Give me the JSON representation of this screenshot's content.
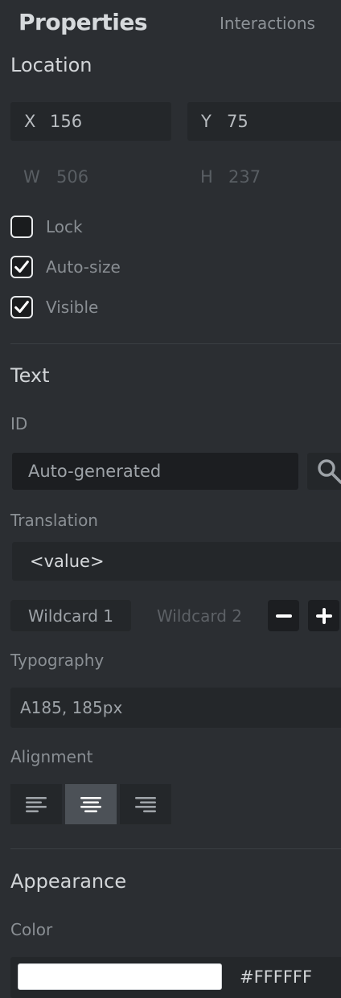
{
  "tabs": {
    "properties": "Properties",
    "interactions": "Interactions"
  },
  "location": {
    "title": "Location",
    "x_label": "X",
    "x_value": "156",
    "y_label": "Y",
    "y_value": "75",
    "w_label": "W",
    "w_value": "506",
    "h_label": "H",
    "h_value": "237",
    "checkboxes": [
      {
        "label": "Lock",
        "checked": false
      },
      {
        "label": "Auto-size",
        "checked": true
      },
      {
        "label": "Visible",
        "checked": true
      }
    ]
  },
  "text": {
    "title": "Text",
    "id_label": "ID",
    "id_placeholder": "Auto-generated",
    "translation_label": "Translation",
    "translation_value": "<value>",
    "wildcards": [
      "Wildcard 1",
      "Wildcard 2"
    ],
    "typography_label": "Typography",
    "typography_value": "A185, 185px",
    "alignment_label": "Alignment",
    "alignment_selected": "center"
  },
  "appearance": {
    "title": "Appearance",
    "color_label": "Color",
    "color_value": "#FFFFFF"
  },
  "icons": {
    "search": "search-icon",
    "minus": "minus-icon",
    "plus": "plus-icon",
    "align_left": "align-left-icon",
    "align_center": "align-center-icon",
    "align_right": "align-right-icon",
    "check": "check-icon"
  }
}
